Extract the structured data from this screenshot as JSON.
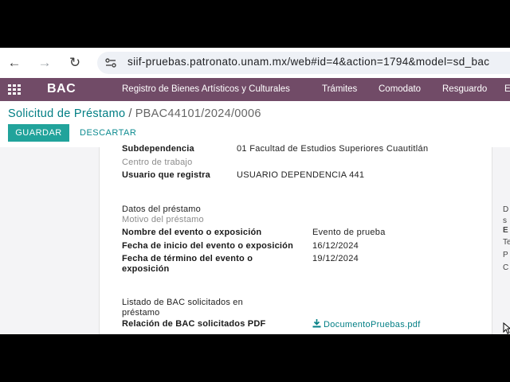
{
  "browser": {
    "url": "siif-pruebas.patronato.unam.mx/web#id=4&action=1794&model=sd_bac"
  },
  "appbar": {
    "app_name": "BAC",
    "menu": [
      "Registro de Bienes Artísticos y Culturales",
      "Trámites",
      "Comodato",
      "Resguardo",
      "E"
    ]
  },
  "breadcrumb": {
    "parent": "Solicitud de Préstamo",
    "separator": "/",
    "current": "PBAC44101/2024/0006"
  },
  "buttons": {
    "save": "GUARDAR",
    "discard": "DESCARTAR"
  },
  "form": {
    "subdependencia_label": "Subdependencia",
    "subdependencia_value": "01 Facultad de Estudios Superiores Cuautitlán",
    "centro_label": "Centro de trabajo",
    "usuario_label": "Usuario que registra",
    "usuario_value": "USUARIO DEPENDENCIA 441",
    "datos_heading": "Datos del préstamo",
    "motivo_label": "Motivo del préstamo",
    "evento_label": "Nombre del evento o exposición",
    "evento_value": "Evento de prueba",
    "inicio_label": "Fecha de inicio del evento o exposición",
    "inicio_value": "16/12/2024",
    "termino_label_1": "Fecha de término del evento o",
    "termino_label_2": "exposición",
    "termino_value": "19/12/2024",
    "listado_label_1": "Listado de BAC solicitados en",
    "listado_label_2": "préstamo",
    "relacion_label": "Relación de BAC solicitados PDF",
    "relacion_value": "DocumentoPruebas.pdf"
  },
  "right_partial": [
    "D",
    "s",
    "E",
    "Te",
    "P",
    "C"
  ]
}
